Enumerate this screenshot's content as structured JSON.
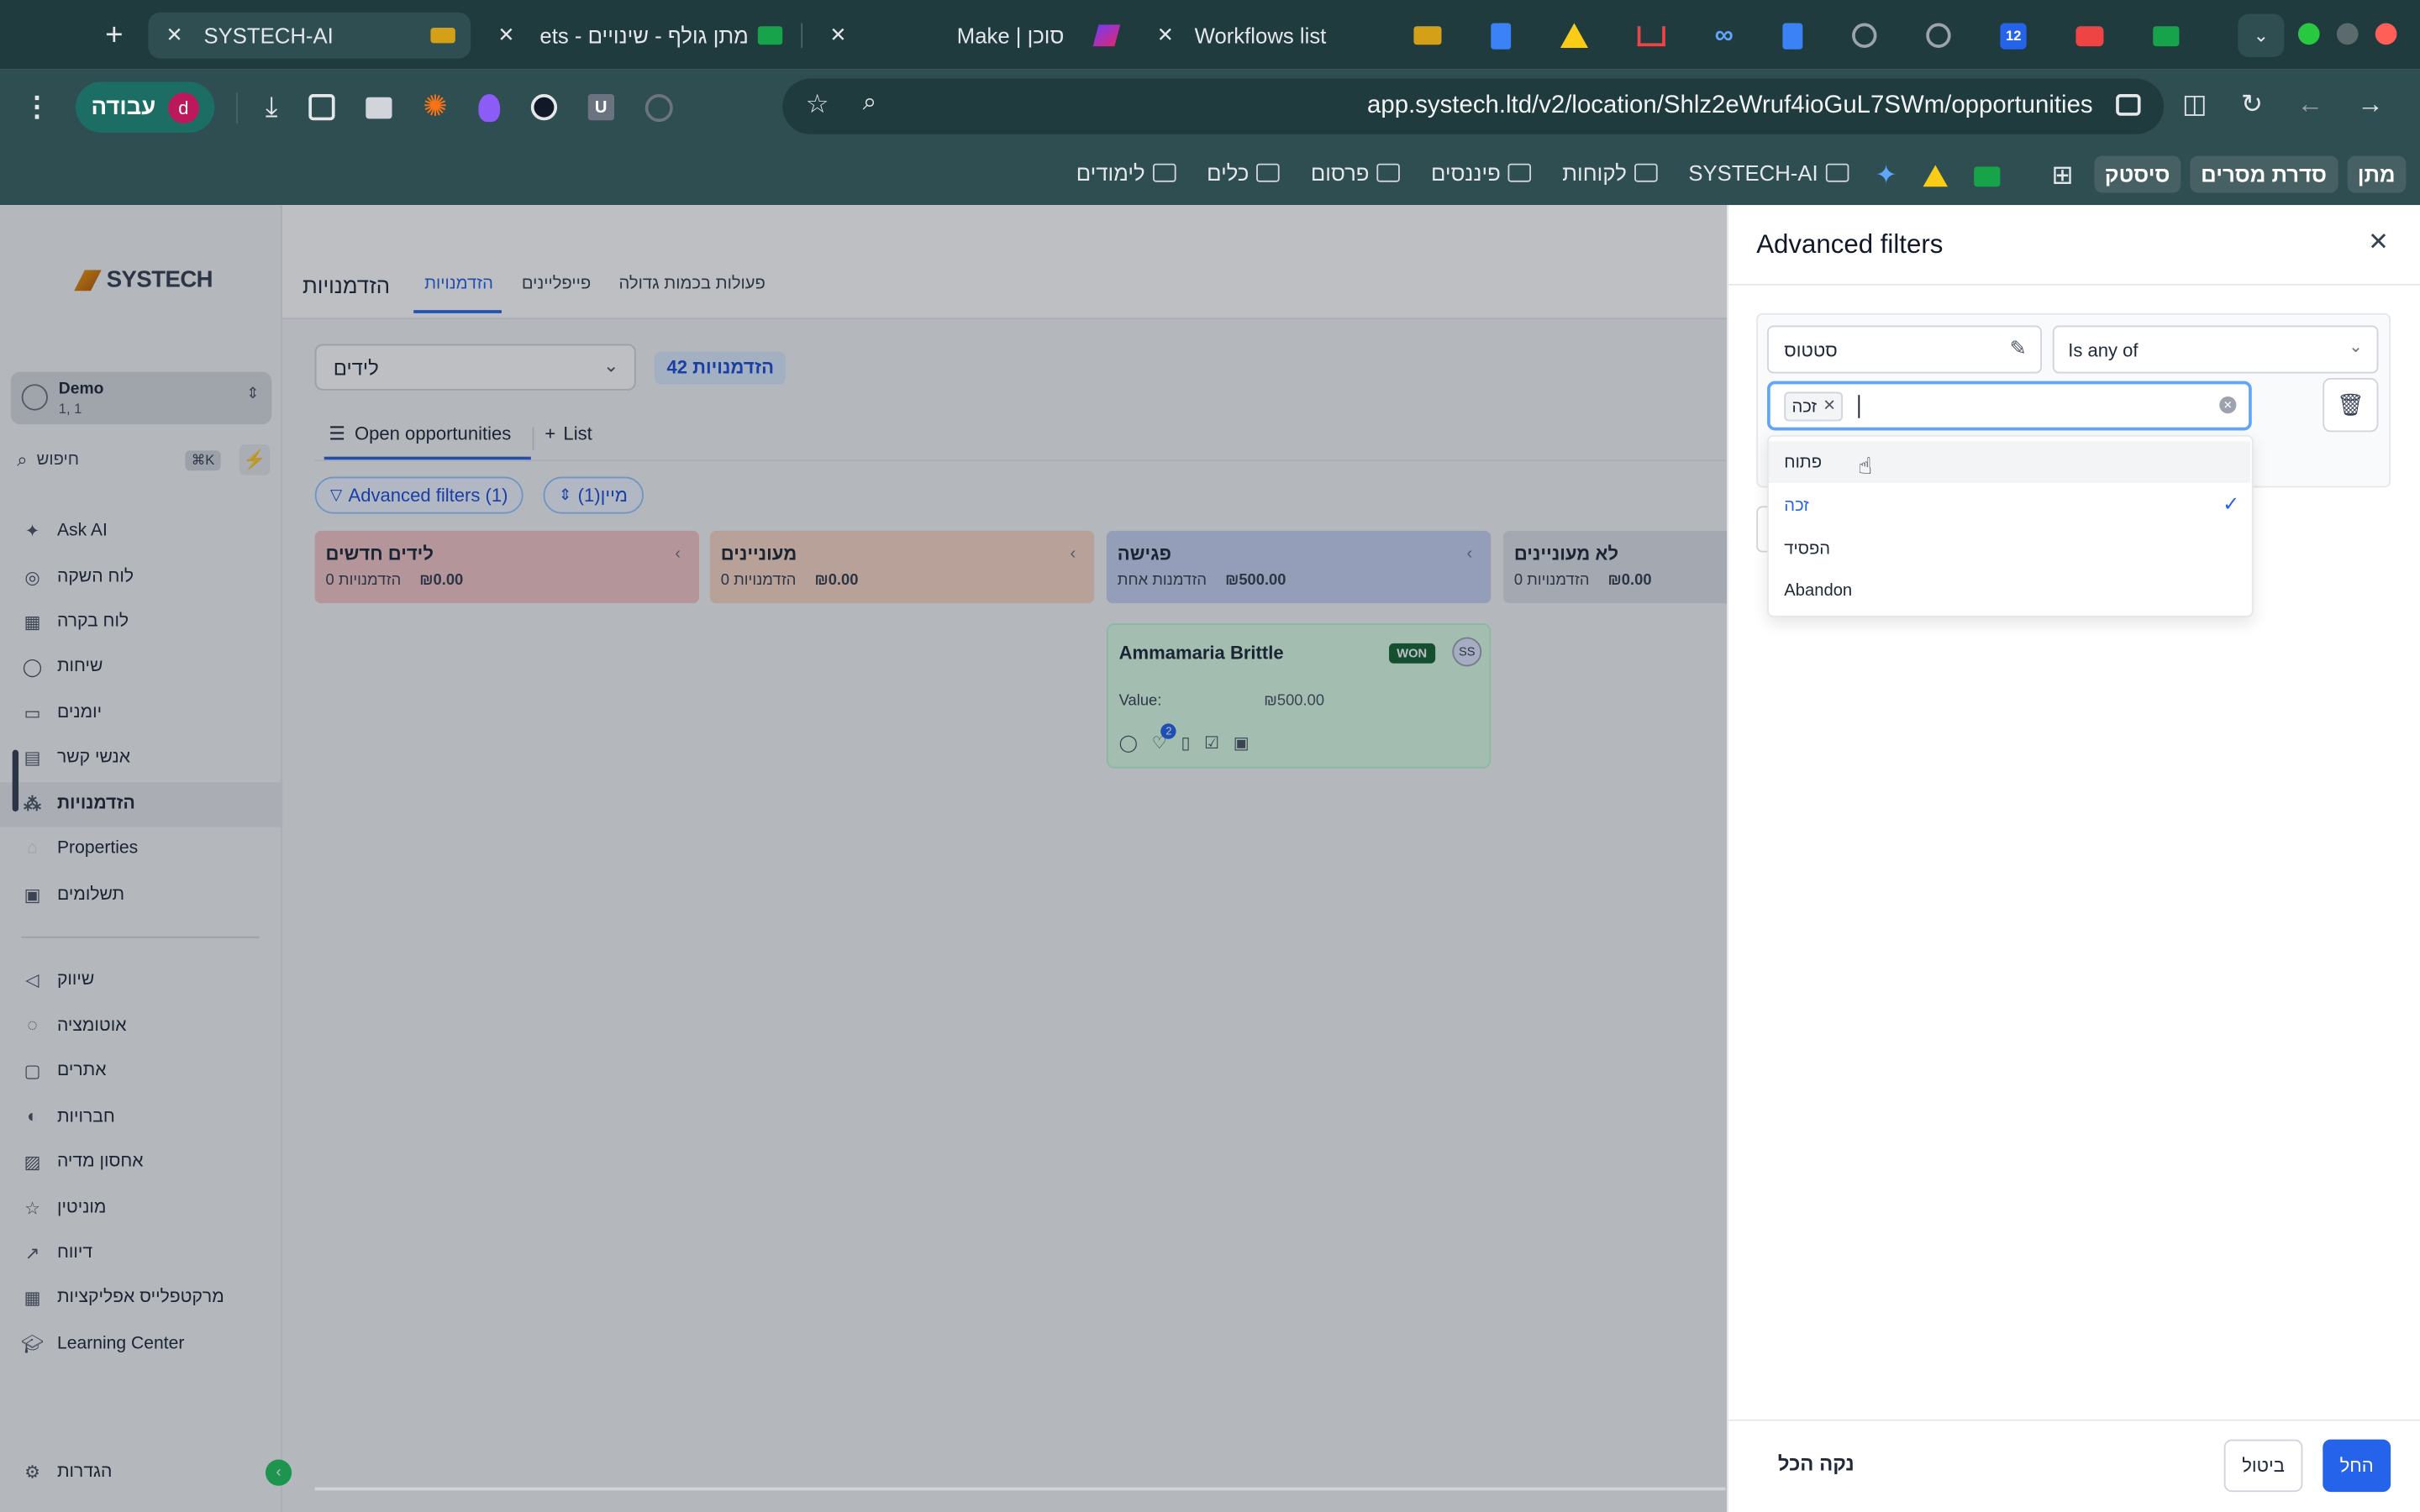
{
  "browser": {
    "tabs": [
      {
        "title": "SYSTECH-AI"
      },
      {
        "title": "מתן גולף - שינויים - ets"
      },
      {
        "title": "Make | סוכן"
      },
      {
        "title": "Workflows list"
      }
    ],
    "url": "app.systech.ltd/v2/location/Shlz2eWruf4ioGuL7SWm/opportunities",
    "profile_label": "עבודה",
    "profile_initial": "d",
    "calendar_badge": "12",
    "bookmarks": [
      "מתן",
      "סדרת מסרים",
      "סיסטק",
      "SYSTECH-AI",
      "לקוחות",
      "פיננסים",
      "פרסום",
      "כלים",
      "לימודים"
    ]
  },
  "sidebar": {
    "logo": "SYSTECH",
    "account_name": "Demo",
    "account_sub": "1, 1",
    "search_placeholder": "חיפוש",
    "search_shortcut": "⌘K",
    "items": [
      {
        "label": "Ask AI",
        "icon": "sparkle-icon"
      },
      {
        "label": "לוח השקה",
        "icon": "rocket-icon"
      },
      {
        "label": "לוח בקרה",
        "icon": "dashboard-icon"
      },
      {
        "label": "שיחות",
        "icon": "chat-icon"
      },
      {
        "label": "יומנים",
        "icon": "calendar-icon"
      },
      {
        "label": "אנשי קשר",
        "icon": "contacts-icon"
      },
      {
        "label": "הזדמנויות",
        "icon": "opportunities-icon"
      },
      {
        "label": "Properties",
        "icon": "house-icon"
      },
      {
        "label": "תשלומים",
        "icon": "payments-icon"
      },
      {
        "label": "שיווק",
        "icon": "megaphone-icon"
      },
      {
        "label": "אוטומציה",
        "icon": "automation-icon"
      },
      {
        "label": "אתרים",
        "icon": "sites-icon"
      },
      {
        "label": "חברויות",
        "icon": "membership-icon"
      },
      {
        "label": "אחסון מדיה",
        "icon": "media-icon"
      },
      {
        "label": "מוניטין",
        "icon": "star-icon"
      },
      {
        "label": "דיווח",
        "icon": "reporting-icon"
      },
      {
        "label": "מרקטפלייס אפליקציות",
        "icon": "apps-icon"
      },
      {
        "label": "Learning Center",
        "icon": "graduation-icon"
      }
    ],
    "settings_label": "הגדרות"
  },
  "header": {
    "title": "הזדמנויות",
    "tabs": [
      "הזדמנויות",
      "פייפליינים",
      "פעולות בכמות גדולה"
    ]
  },
  "toolbar": {
    "pipeline": "לידים",
    "count_badge": "42 הזדמנויות",
    "view_tabs": [
      "Open opportunities",
      "List"
    ],
    "advanced_filters": "Advanced filters (1)",
    "sort": "מיין(1)"
  },
  "columns": [
    {
      "title": "לידים חדשים",
      "amount": "₪0.00",
      "count": "0 הזדמנויות",
      "color": "#f3c5c5"
    },
    {
      "title": "מעוניינים",
      "amount": "₪0.00",
      "count": "0 הזדמנויות",
      "color": "#f8d6c4"
    },
    {
      "title": "פגישה",
      "amount": "₪500.00",
      "count": "הזדמנות אחת",
      "color": "#c7d2f0"
    },
    {
      "title": "לא מעוניינים",
      "amount": "₪0.00",
      "count": "0 הזדמנויות",
      "color": "#dde1e7"
    }
  ],
  "card": {
    "name": "Ammamaria Brittle",
    "badge": "WON",
    "avatar": "SS",
    "value_label": "Value:",
    "value": "₪500.00",
    "notif": "2"
  },
  "panel": {
    "title": "Advanced filters",
    "field": "סטטוס",
    "operator": "Is any of",
    "chip": "זכה",
    "options": [
      {
        "label": "פתוח",
        "selected": false
      },
      {
        "label": "זכה",
        "selected": true
      },
      {
        "label": "הפסיד",
        "selected": false
      },
      {
        "label": "Abandon",
        "selected": false
      }
    ],
    "clear_all": "נקה הכל",
    "cancel": "ביטול",
    "apply": "החל"
  }
}
